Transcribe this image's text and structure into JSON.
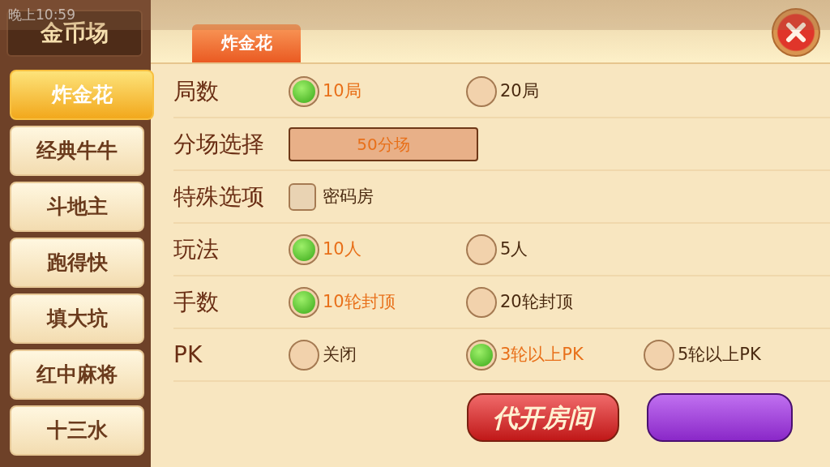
{
  "status_bar": {
    "time": "晚上10:59"
  },
  "header": {
    "title": "金币场"
  },
  "sidebar": {
    "items": [
      {
        "label": "炸金花",
        "selected": true
      },
      {
        "label": "经典牛牛",
        "selected": false
      },
      {
        "label": "斗地主",
        "selected": false
      },
      {
        "label": "跑得快",
        "selected": false
      },
      {
        "label": "填大坑",
        "selected": false
      },
      {
        "label": "红中麻将",
        "selected": false
      },
      {
        "label": "十三水",
        "selected": false
      }
    ]
  },
  "tabs": [
    {
      "label": "炸金花",
      "selected": true
    }
  ],
  "options": [
    {
      "kind": "radio",
      "label": "局数",
      "choices": [
        {
          "label": "10局",
          "selected": true
        },
        {
          "label": "20局",
          "selected": false
        }
      ]
    },
    {
      "kind": "select",
      "label": "分场选择",
      "value": "50分场"
    },
    {
      "kind": "checkbox",
      "label": "特殊选项",
      "choices": [
        {
          "label": "密码房",
          "checked": false
        }
      ]
    },
    {
      "kind": "radio",
      "label": "玩法",
      "choices": [
        {
          "label": "10人",
          "selected": true
        },
        {
          "label": "5人",
          "selected": false
        }
      ]
    },
    {
      "kind": "radio",
      "label": "手数",
      "choices": [
        {
          "label": "10轮封顶",
          "selected": true
        },
        {
          "label": "20轮封顶",
          "selected": false
        }
      ]
    },
    {
      "kind": "radio",
      "label": "PK",
      "choices": [
        {
          "label": "关闭",
          "selected": false
        },
        {
          "label": "3轮以上PK",
          "selected": true
        },
        {
          "label": "5轮以上PK",
          "selected": false
        }
      ]
    }
  ],
  "buttons": [
    {
      "kind": "red",
      "label": "代开房间"
    },
    {
      "kind": "purple"
    }
  ]
}
